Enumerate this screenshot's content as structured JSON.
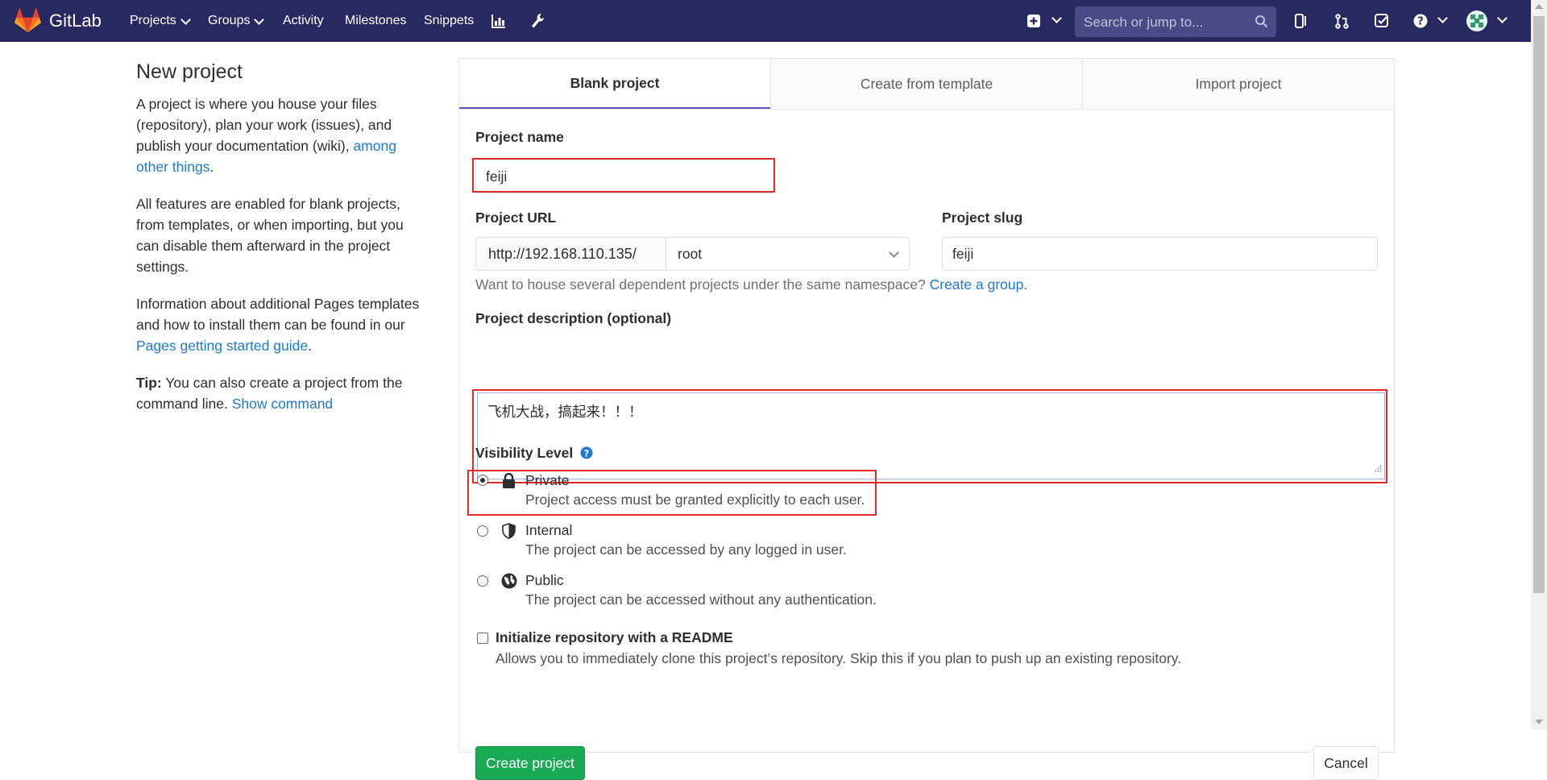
{
  "nav": {
    "brand": "GitLab",
    "projects": "Projects",
    "groups": "Groups",
    "activity": "Activity",
    "milestones": "Milestones",
    "snippets": "Snippets",
    "search_placeholder": "Search or jump to..."
  },
  "sidebar": {
    "title": "New project",
    "p1_text": "A project is where you house your files (repository), plan your work (issues), and publish your documentation (wiki),",
    "p1_link": "among other things",
    "p1_end": ".",
    "p2_text": "All features are enabled for blank projects, from templates, or when importing, but you can disable them afterward in the project settings.",
    "p3_text": "Information about additional Pages templates and how to install them can be found in our",
    "p3_link": "Pages getting started guide",
    "p3_end": ".",
    "tip_label": "Tip:",
    "tip_text": "You can also create a project from the command line.",
    "tip_link": "Show command"
  },
  "tabs": [
    "Blank project",
    "Create from template",
    "Import project"
  ],
  "form": {
    "project_name_label": "Project name",
    "project_name_value": "feiji",
    "project_url_label": "Project URL",
    "url_prefix": "http://192.168.110.135/",
    "namespace": "root",
    "project_slug_label": "Project slug",
    "project_slug_value": "feiji",
    "help_text": "Want to house several dependent projects under the same namespace?",
    "help_link": "Create a group.",
    "description_label": "Project description (optional)",
    "description_value": "飞机大战，搞起来！！！",
    "visibility_label": "Visibility Level",
    "options": [
      {
        "title": "Private",
        "desc": "Project access must be granted explicitly to each user.",
        "icon": "lock-icon",
        "checked": true
      },
      {
        "title": "Internal",
        "desc": "The project can be accessed by any logged in user.",
        "icon": "shield-icon",
        "checked": false
      },
      {
        "title": "Public",
        "desc": "The project can be accessed without any authentication.",
        "icon": "globe-icon",
        "checked": false
      }
    ],
    "readme_label": "Initialize repository with a README",
    "readme_desc": "Allows you to immediately clone this project’s repository. Skip this if you plan to push up an existing repository.",
    "create_button": "Create project",
    "cancel_button": "Cancel"
  },
  "colors": {
    "navbar": "#292961",
    "link": "#1f78d1",
    "primary": "#1aaa55",
    "highlight": "#e22a2a",
    "tab_active": "#6b4fbb"
  }
}
